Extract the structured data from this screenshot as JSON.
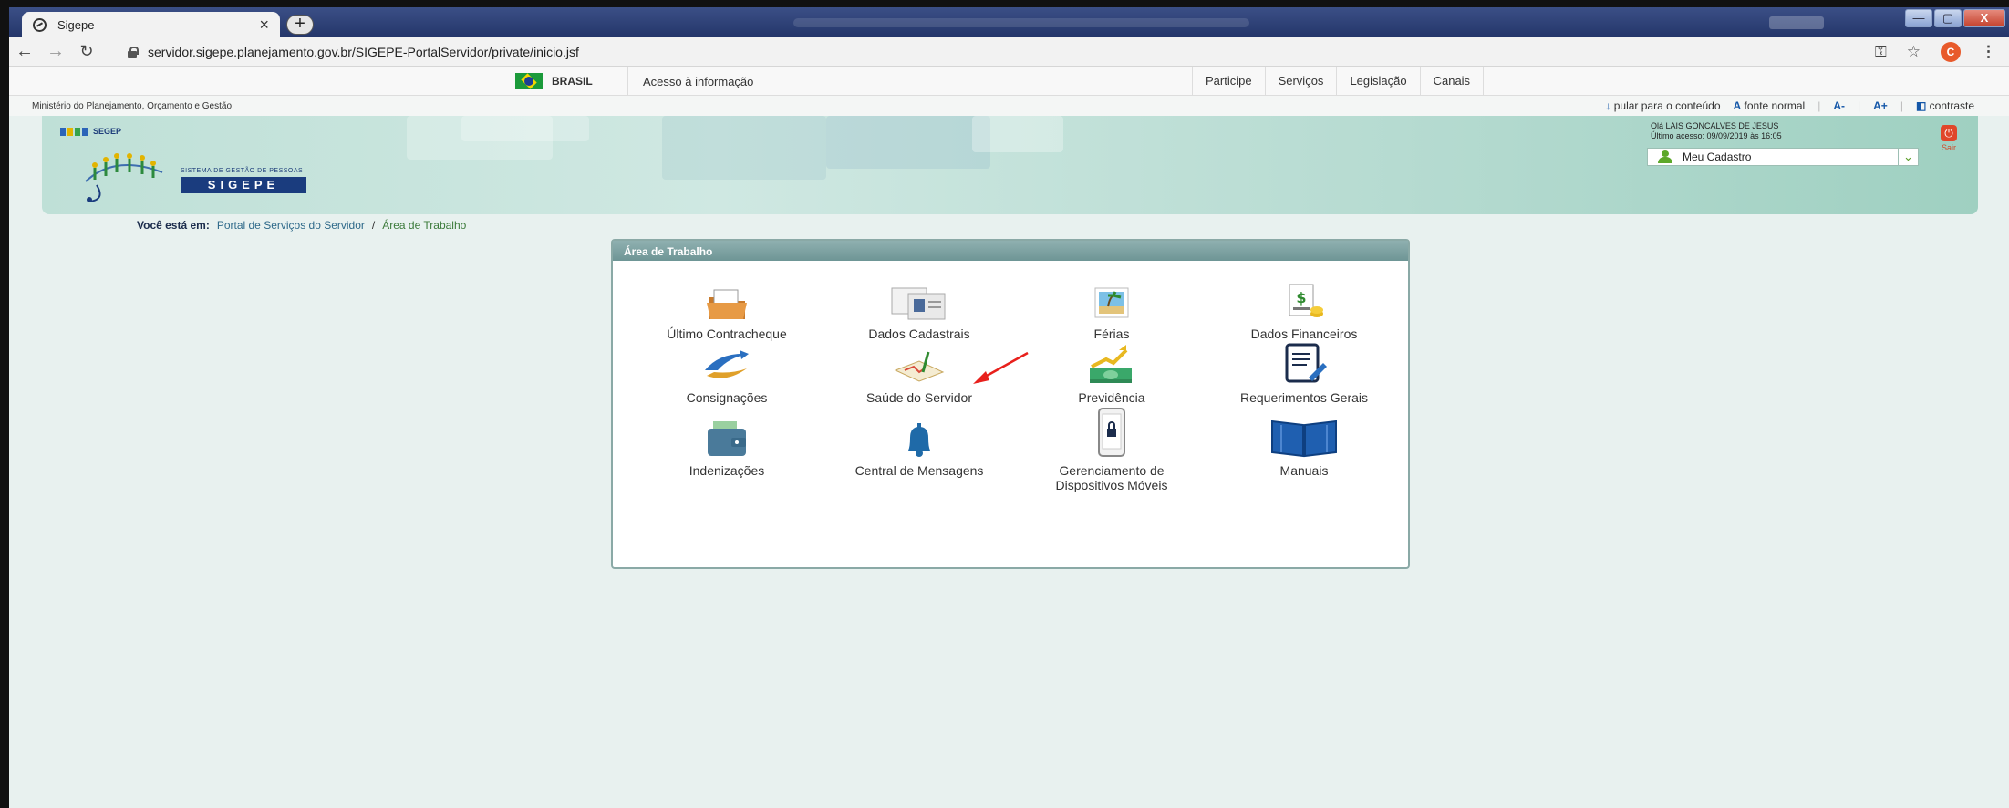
{
  "browser": {
    "tab_title": "Sigepe",
    "tab_close": "×",
    "new_tab": "+",
    "url": "servidor.sigepe.planejamento.gov.br/SIGEPE-PortalServidor/private/inicio.jsf",
    "profile_initial": "C",
    "window_controls": [
      "—",
      "▢",
      "X"
    ]
  },
  "govbar": {
    "brasil": "BRASIL",
    "acesso": "Acesso à informação",
    "links": [
      "Participe",
      "Serviços",
      "Legislação",
      "Canais"
    ]
  },
  "accbar": {
    "ministry": "Ministério do Planejamento, Orçamento e Gestão",
    "skip": "pular para o conteúdo",
    "font_normal": "fonte normal",
    "font_minus": "A-",
    "font_plus": "A+",
    "contrast": "contraste"
  },
  "header": {
    "segep": "SEGEP",
    "sigepe_sub": "SISTEMA DE GESTÃO DE PESSOAS",
    "sigepe": "SIGEPE",
    "greeting": "Olá LAIS GONCALVES DE JESUS",
    "last_access": "Último acesso: 09/09/2019 às 16:05",
    "meu_cadastro": "Meu Cadastro",
    "sair": "Sair"
  },
  "breadcrumb": {
    "prefix": "Você está em:",
    "portal": "Portal de Serviços do Servidor",
    "sep": "/",
    "current": "Área de Trabalho"
  },
  "panel": {
    "title": "Área de Trabalho",
    "items": [
      {
        "label": "Último Contracheque"
      },
      {
        "label": "Dados Cadastrais"
      },
      {
        "label": "Férias"
      },
      {
        "label": "Dados Financeiros"
      },
      {
        "label": "Consignações"
      },
      {
        "label": "Saúde do Servidor"
      },
      {
        "label": "Previdência"
      },
      {
        "label": "Requerimentos Gerais"
      },
      {
        "label": "Indenizações"
      },
      {
        "label": "Central de Mensagens"
      },
      {
        "label": "Gerenciamento de Dispositivos Móveis"
      },
      {
        "label": "Manuais"
      }
    ]
  },
  "colors": {
    "header_green": "#bfe0d7",
    "panel_head": "#7ea3a3",
    "annotation_arrow": "#e8201c"
  }
}
